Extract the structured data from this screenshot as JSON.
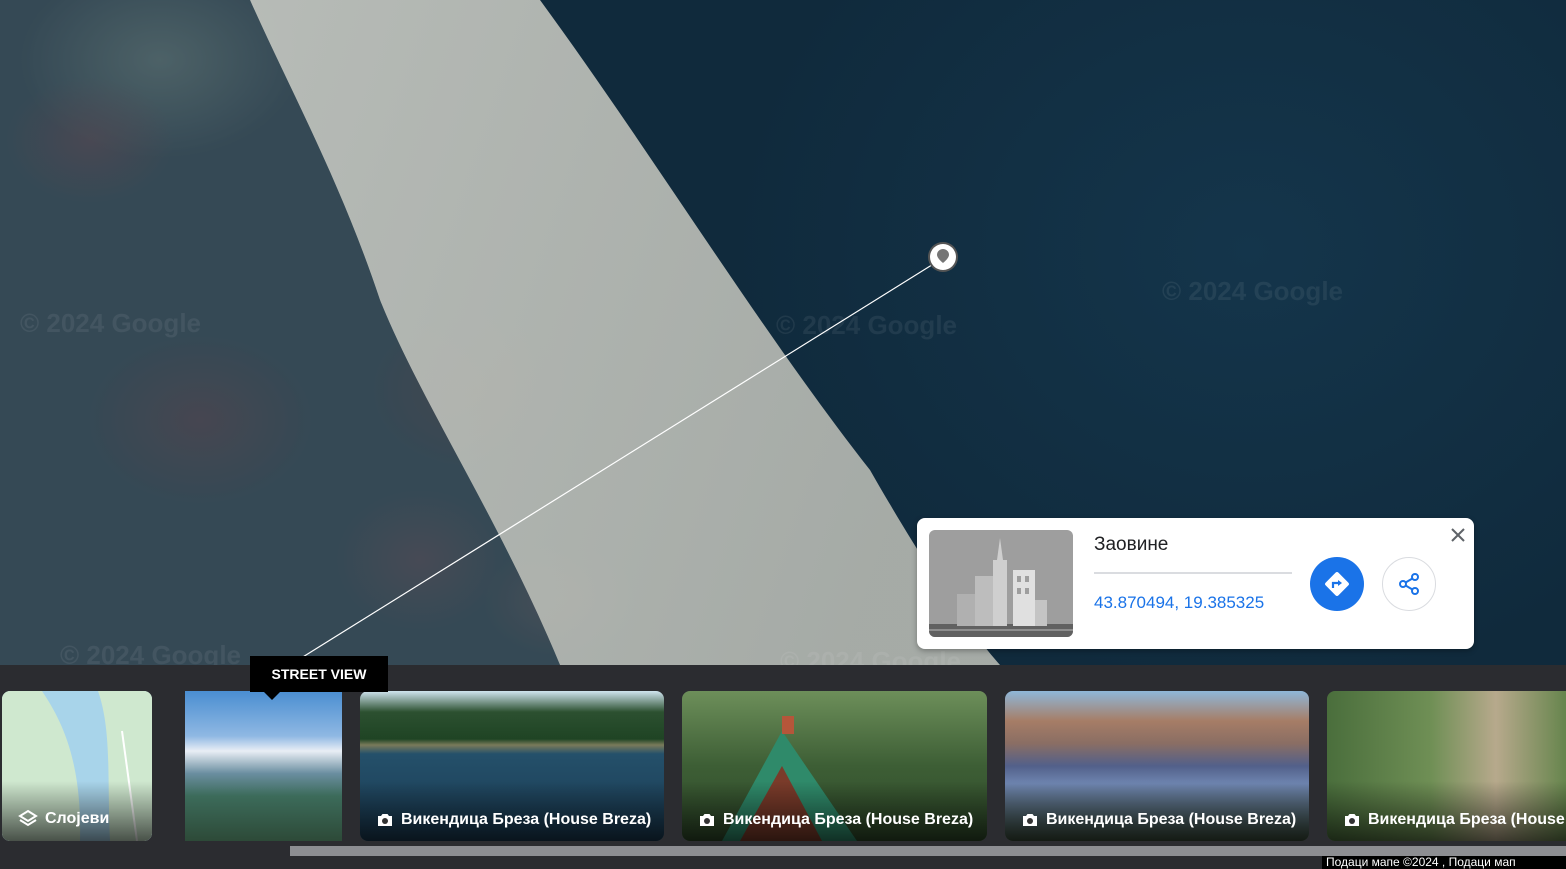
{
  "map": {
    "watermarks": [
      "© 2024 Google",
      "© 2024 Google",
      "© 2024 Google",
      "© 2024 Google",
      "© 2024 Google"
    ]
  },
  "info_card": {
    "title": "Заовине",
    "coordinates": "43.870494, 19.385325",
    "directions_icon": "directions-icon",
    "share_icon": "share-icon",
    "close_icon": "close-icon"
  },
  "tooltip": {
    "label": "STREET VIEW"
  },
  "strip": {
    "layers_label": "Слојеви",
    "photos": [
      {
        "caption": "Викендица Бреза (House Breza)"
      },
      {
        "caption": "Викендица Бреза (House Breza)"
      },
      {
        "caption": "Викендица Бреза (House Breza)"
      },
      {
        "caption": "Викендица Бреза (House Breza)"
      }
    ]
  },
  "attribution": "Подаци мапе ©2024 , Подаци мап"
}
